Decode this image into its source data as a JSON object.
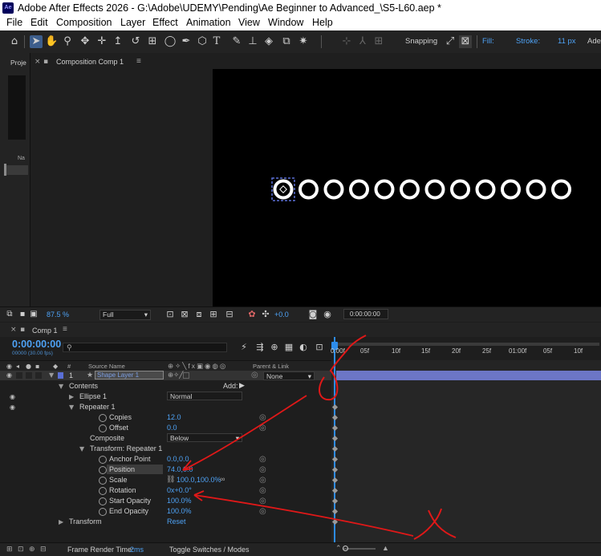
{
  "window": {
    "app_icon": "Ae",
    "title": "Adobe After Effects 2026 - G:\\Adobe\\UDEMY\\Pending\\Ae Beginner to Advanced_\\S5-L60.aep *"
  },
  "menu": [
    "File",
    "Edit",
    "Composition",
    "Layer",
    "Effect",
    "Animation",
    "View",
    "Window",
    "Help"
  ],
  "toolbar": {
    "snapping_label": "Snapping",
    "fill_label": "Fill:",
    "stroke_label": "Stroke:",
    "stroke_width": "11 px",
    "overflow_label": "Ade",
    "fill_color": "#c0282e",
    "stroke_color": "#ffffff"
  },
  "project_panel": {
    "tab_label": "Proje",
    "column_label": "Na"
  },
  "composition_panel": {
    "tab_label": "Composition Comp 1"
  },
  "viewer": {
    "copies": 12,
    "ring_color": "#ffffff",
    "background": "#000000"
  },
  "viewer_bar": {
    "zoom": "87.5 %",
    "resolution": "Full",
    "exposure": "+0.0",
    "timecode": "0:00:00:00"
  },
  "timeline": {
    "tab_label": "Comp 1",
    "current_time": "0:00:00:00",
    "frame_info": "00000 (30.00 fps)",
    "search_placeholder": "",
    "columns": {
      "number": "#",
      "source_name": "Source Name",
      "parent_link": "Parent & Link"
    },
    "layer": {
      "index": "1",
      "name": "Shape Layer 1",
      "parent": "None",
      "label_color": "#5a6fd6"
    },
    "rows": {
      "contents": "Contents",
      "add_label": "Add:",
      "ellipse": "Ellipse 1",
      "ellipse_mode": "Normal",
      "repeater": "Repeater 1",
      "copies_label": "Copies",
      "copies_value": "12.0",
      "offset_label": "Offset",
      "offset_value": "0.0",
      "composite_label": "Composite",
      "composite_value": "Below",
      "transform_repeater": "Transform: Repeater 1",
      "anchor_label": "Anchor Point",
      "anchor_value": "0.0,0.0",
      "position_label": "Position",
      "position_value": "74.0,0.0",
      "scale_label": "Scale",
      "scale_value": "100.0,100.0%",
      "rotation_label": "Rotation",
      "rotation_value": "0x+0.0°",
      "start_opacity_label": "Start Opacity",
      "start_opacity_value": "100.0%",
      "end_opacity_label": "End Opacity",
      "end_opacity_value": "100.0%",
      "transform": "Transform",
      "reset": "Reset"
    },
    "ruler": [
      "0:00f",
      "05f",
      "10f",
      "15f",
      "20f",
      "25f",
      "01:00f",
      "05f",
      "10f"
    ],
    "status": {
      "render_time_label": "Frame Render Time:",
      "render_time_value": "2ms",
      "toggle_label": "Toggle Switches / Modes"
    }
  },
  "annotation_color": "#e01818",
  "accent": "#2d8ceb"
}
